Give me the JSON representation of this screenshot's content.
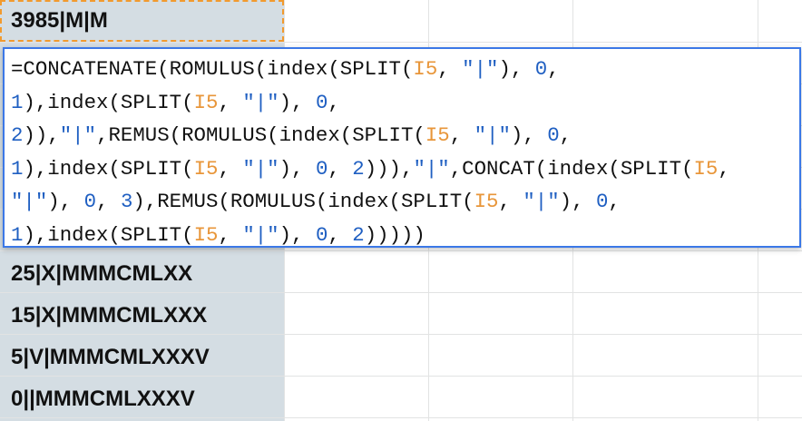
{
  "spreadsheet": {
    "active_cell_value": "3985|M|M",
    "rows": [
      "25|X|MMMCMLXX",
      "15|X|MMMCMLXXX",
      "5|V|MMMCMLXXXV",
      "0||MMMCMLXXXV"
    ]
  },
  "formula_editor": {
    "lines": [
      [
        {
          "t": "=CONCATENATE(ROMULUS(index(SPLIT(",
          "k": "txt"
        },
        {
          "t": "I5",
          "k": "ref"
        },
        {
          "t": ", ",
          "k": "txt"
        },
        {
          "t": "\"|\"",
          "k": "str"
        },
        {
          "t": "), ",
          "k": "txt"
        },
        {
          "t": "0",
          "k": "num"
        },
        {
          "t": ",",
          "k": "txt"
        }
      ],
      [
        {
          "t": "1",
          "k": "num"
        },
        {
          "t": "),index(SPLIT(",
          "k": "txt"
        },
        {
          "t": "I5",
          "k": "ref"
        },
        {
          "t": ", ",
          "k": "txt"
        },
        {
          "t": "\"|\"",
          "k": "str"
        },
        {
          "t": "), ",
          "k": "txt"
        },
        {
          "t": "0",
          "k": "num"
        },
        {
          "t": ",",
          "k": "txt"
        }
      ],
      [
        {
          "t": "2",
          "k": "num"
        },
        {
          "t": ")),",
          "k": "txt"
        },
        {
          "t": "\"|\"",
          "k": "str"
        },
        {
          "t": ",REMUS(ROMULUS(index(SPLIT(",
          "k": "txt"
        },
        {
          "t": "I5",
          "k": "ref"
        },
        {
          "t": ", ",
          "k": "txt"
        },
        {
          "t": "\"|\"",
          "k": "str"
        },
        {
          "t": "), ",
          "k": "txt"
        },
        {
          "t": "0",
          "k": "num"
        },
        {
          "t": ",",
          "k": "txt"
        }
      ],
      [
        {
          "t": "1",
          "k": "num"
        },
        {
          "t": "),index(SPLIT(",
          "k": "txt"
        },
        {
          "t": "I5",
          "k": "ref"
        },
        {
          "t": ", ",
          "k": "txt"
        },
        {
          "t": "\"|\"",
          "k": "str"
        },
        {
          "t": "), ",
          "k": "txt"
        },
        {
          "t": "0",
          "k": "num"
        },
        {
          "t": ", ",
          "k": "txt"
        },
        {
          "t": "2",
          "k": "num"
        },
        {
          "t": "))),",
          "k": "txt"
        },
        {
          "t": "\"|\"",
          "k": "str"
        },
        {
          "t": ",CONCAT(index(SPLIT(",
          "k": "txt"
        },
        {
          "t": "I5",
          "k": "ref"
        },
        {
          "t": ",",
          "k": "txt"
        }
      ],
      [
        {
          "t": "\"|\"",
          "k": "str"
        },
        {
          "t": "), ",
          "k": "txt"
        },
        {
          "t": "0",
          "k": "num"
        },
        {
          "t": ", ",
          "k": "txt"
        },
        {
          "t": "3",
          "k": "num"
        },
        {
          "t": "),REMUS(ROMULUS(index(SPLIT(",
          "k": "txt"
        },
        {
          "t": "I5",
          "k": "ref"
        },
        {
          "t": ", ",
          "k": "txt"
        },
        {
          "t": "\"|\"",
          "k": "str"
        },
        {
          "t": "), ",
          "k": "txt"
        },
        {
          "t": "0",
          "k": "num"
        },
        {
          "t": ",",
          "k": "txt"
        }
      ],
      [
        {
          "t": "1",
          "k": "num"
        },
        {
          "t": "),index(SPLIT(",
          "k": "txt"
        },
        {
          "t": "I5",
          "k": "ref"
        },
        {
          "t": ", ",
          "k": "txt"
        },
        {
          "t": "\"|\"",
          "k": "str"
        },
        {
          "t": "), ",
          "k": "txt"
        },
        {
          "t": "0",
          "k": "num"
        },
        {
          "t": ", ",
          "k": "txt"
        },
        {
          "t": "2",
          "k": "num"
        },
        {
          "t": ")))))",
          "k": "txt"
        }
      ]
    ]
  },
  "colors": {
    "cell_ref": "#e8963a",
    "number": "#1f5fc2",
    "editor_border": "#3b78e7",
    "active_border": "#f19a2e",
    "selected_column": "#d4dde3"
  }
}
